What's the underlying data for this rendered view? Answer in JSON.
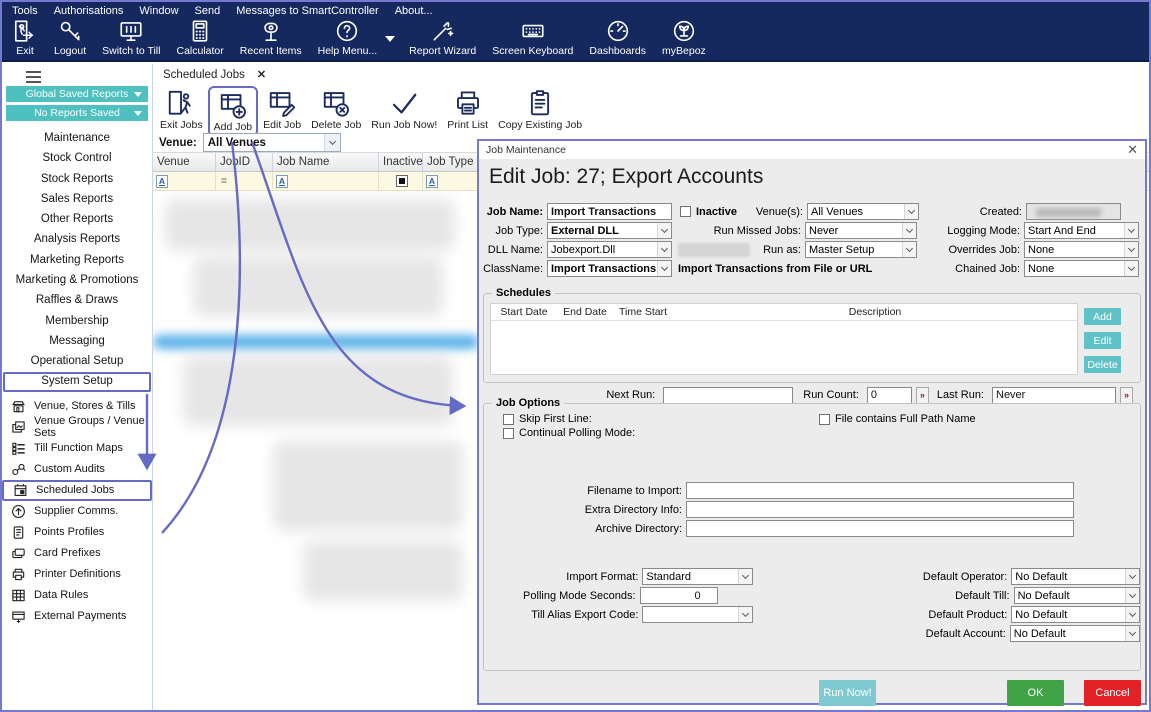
{
  "menubar": {
    "items": [
      "Tools",
      "Authorisations",
      "Window",
      "Send",
      "Messages to SmartController",
      "About..."
    ]
  },
  "toolbar": {
    "items": [
      {
        "label": "Exit"
      },
      {
        "label": "Logout"
      },
      {
        "label": "Switch to Till"
      },
      {
        "label": "Calculator"
      },
      {
        "label": "Recent Items"
      },
      {
        "label": "Help Menu..."
      },
      {
        "label": "Report Wizard"
      },
      {
        "label": "Screen Keyboard"
      },
      {
        "label": "Dashboards"
      },
      {
        "label": "myBepoz"
      }
    ]
  },
  "sidebar": {
    "saved_reports_dropdown": "Global Saved Reports",
    "no_reports_dropdown": "No Reports Saved",
    "nav_items": [
      "Maintenance",
      "Stock Control",
      "Stock Reports",
      "Sales Reports",
      "Other Reports",
      "Analysis Reports",
      "Marketing Reports",
      "Marketing & Promotions",
      "Raffles & Draws",
      "Membership",
      "Messaging",
      "Operational Setup",
      "System Setup"
    ],
    "setup_items": [
      "Venue, Stores & Tills",
      "Venue Groups / Venue Sets",
      "Till Function Maps",
      "Custom Audits",
      "Scheduled Jobs",
      "Supplier Comms.",
      "Points Profiles",
      "Card Prefixes",
      "Printer Definitions",
      "Data Rules",
      "External Payments"
    ]
  },
  "jobs_panel": {
    "tab_label": "Scheduled Jobs",
    "tab_close": "✕",
    "toolbar": [
      "Exit Jobs",
      "Add Job",
      "Edit Job",
      "Delete Job",
      "Run Job Now!",
      "Print List",
      "Copy Existing Job"
    ],
    "venue_label": "Venue:",
    "venue_value": "All Venues",
    "columns": [
      "Venue",
      "JobID",
      "Job Name",
      "Inactive",
      "Job Type"
    ],
    "filter_a": "A",
    "filter_eq": "="
  },
  "dialog": {
    "title": "Job Maintenance",
    "close": "✕",
    "heading": "Edit Job: 27; Export Accounts",
    "job_name": {
      "label": "Job Name:",
      "value": "Import Transactions"
    },
    "inactive_label": "Inactive",
    "venues": {
      "label": "Venue(s):",
      "value": "All Venues"
    },
    "created_label": "Created:",
    "job_type": {
      "label": "Job Type:",
      "value": "External DLL"
    },
    "run_missed": {
      "label": "Run Missed Jobs:",
      "value": "Never"
    },
    "logging": {
      "label": "Logging Mode:",
      "value": "Start And End"
    },
    "dll": {
      "label": "DLL Name:",
      "value": "Jobexport.Dll"
    },
    "run_as": {
      "label": "Run as:",
      "value": "Master Setup"
    },
    "overrides": {
      "label": "Overrides Job:",
      "value": "None"
    },
    "classname": {
      "label": "ClassName:",
      "value": "Import Transactions"
    },
    "class_desc": "Import Transactions from File or URL",
    "chained": {
      "label": "Chained Job:",
      "value": "None"
    },
    "schedules": {
      "legend": "Schedules",
      "columns": [
        "Start Date",
        "End Date",
        "Time Start",
        "Description"
      ],
      "add": "Add",
      "edit": "Edit",
      "delete": "Delete"
    },
    "run_info": {
      "next_run_label": "Next Run:",
      "run_count_label": "Run Count:",
      "run_count_value": "0",
      "last_run_label": "Last Run:",
      "last_run_value": "Never",
      "spinner": "»"
    },
    "job_options": {
      "legend": "Job Options",
      "cb_skip": "Skip First Line:",
      "cb_polling": "Continual Polling Mode:",
      "cb_fullpath": "File contains Full Path Name",
      "filename_label": "Filename to Import:",
      "extra_dir_label": "Extra Directory Info:",
      "archive_label": "Archive Directory:",
      "import_format": {
        "label": "Import Format:",
        "value": "Standard"
      },
      "polling_seconds": {
        "label": "Polling Mode Seconds:",
        "value": "0"
      },
      "till_alias_label": "Till Alias Export Code:",
      "defaults": [
        {
          "label": "Default Operator:",
          "value": "No Default"
        },
        {
          "label": "Default Till:",
          "value": "No Default"
        },
        {
          "label": "Default Product:",
          "value": "No Default"
        },
        {
          "label": "Default Account:",
          "value": "No Default"
        }
      ]
    },
    "buttons": {
      "run_now": "Run Now!",
      "ok": "OK",
      "cancel": "Cancel"
    }
  },
  "colors": {
    "navy": "#16295f",
    "annotation": "#656bc4",
    "teal": "#4fc0c0",
    "ok_green": "#41a347",
    "cancel_red": "#e32227",
    "run_now_teal": "#7fcad0"
  }
}
